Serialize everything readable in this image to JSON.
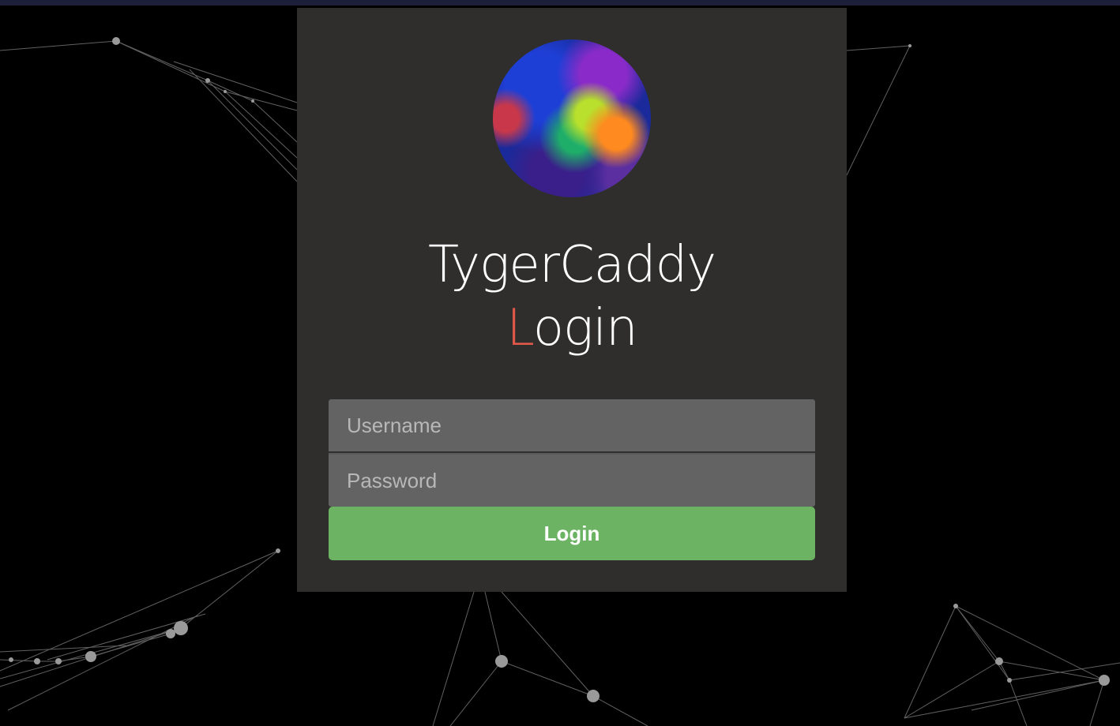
{
  "header": {
    "title_line1": "TygerCaddy",
    "title_line2_accent": "L",
    "title_line2_rest": "ogin"
  },
  "form": {
    "username_placeholder": "Username",
    "password_placeholder": "Password",
    "login_label": "Login"
  },
  "colors": {
    "page_background": "#000000",
    "card_background": "#2f2e2d",
    "accent": "#e0584a",
    "input_background": "#636363",
    "button_background": "#6cb364"
  },
  "icons": {
    "avatar": "nebula-logo-image"
  }
}
